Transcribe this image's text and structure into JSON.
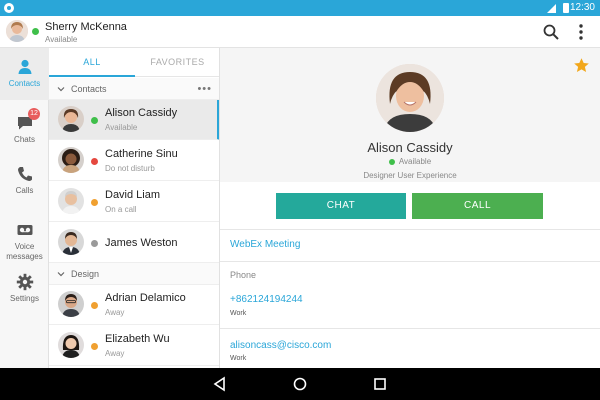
{
  "status_bar": {
    "time": "12:30"
  },
  "header": {
    "user_name": "Sherry McKenna",
    "user_status": "Available"
  },
  "nav": {
    "items": [
      {
        "label": "Contacts",
        "icon": "person-icon"
      },
      {
        "label": "Chats",
        "icon": "chat-icon",
        "badge": "12"
      },
      {
        "label": "Calls",
        "icon": "phone-icon"
      },
      {
        "label": "Voice messages",
        "icon": "voicemail-icon"
      },
      {
        "label": "Settings",
        "icon": "gear-icon"
      }
    ]
  },
  "tabs": {
    "all": "ALL",
    "favorites": "FAVORITES"
  },
  "groups": [
    {
      "name": "Contacts",
      "contacts": [
        {
          "name": "Alison Cassidy",
          "status": "Available",
          "status_color": "#3fbf4a"
        },
        {
          "name": "Catherine Sinu",
          "status": "Do not disturb",
          "status_color": "#e5483f"
        },
        {
          "name": "David Liam",
          "status": "On a call",
          "status_color": "#f0a030"
        },
        {
          "name": "James Weston",
          "status": "",
          "status_color": "#9a9a9a"
        }
      ]
    },
    {
      "name": "Design",
      "contacts": [
        {
          "name": "Adrian Delamico",
          "status": "Away",
          "status_color": "#f0a030"
        },
        {
          "name": "Elizabeth Wu",
          "status": "Away",
          "status_color": "#f0a030"
        }
      ]
    }
  ],
  "detail": {
    "name": "Alison Cassidy",
    "status": "Available",
    "title": "Designer User Experience",
    "chat_label": "CHAT",
    "call_label": "CALL",
    "webex_label": "WebEx Meeting",
    "phone_section": "Phone",
    "phone": "+862124194244",
    "phone_type": "Work",
    "email": "alisoncass@cisco.com",
    "email_type": "Work"
  },
  "colors": {
    "accent": "#2aa6d8",
    "chat_button": "#24a99b",
    "call_button": "#4caf50",
    "favorite_star": "#f2a71b"
  }
}
